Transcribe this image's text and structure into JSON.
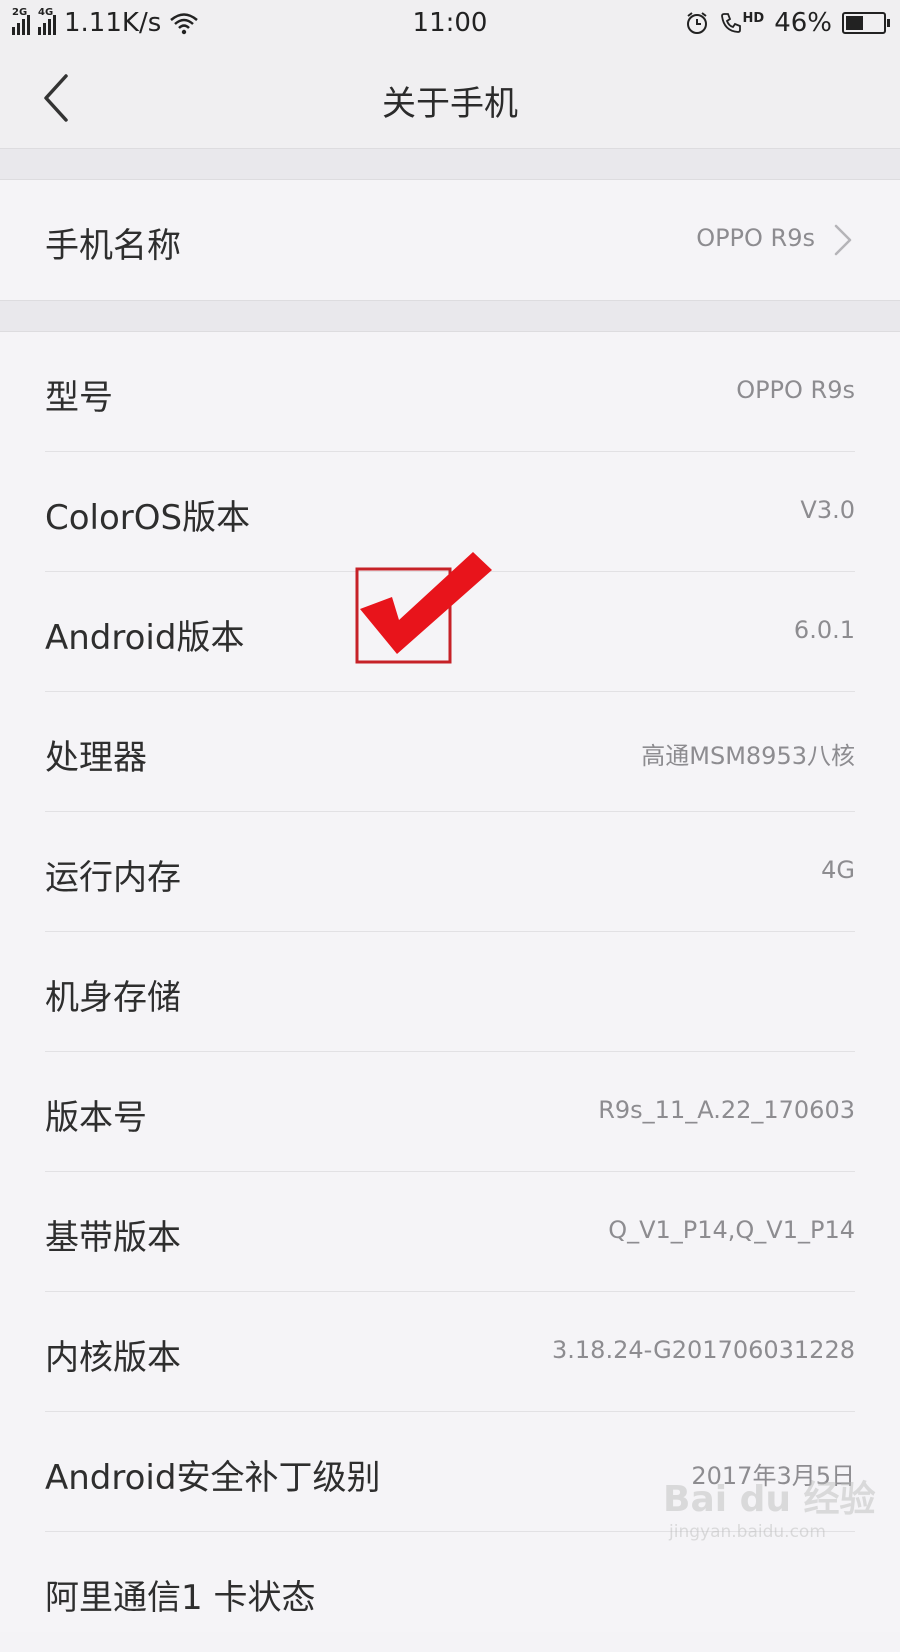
{
  "status_bar": {
    "signal_1_label": "2G",
    "signal_2_label": "4G",
    "net_speed": "1.11K/s",
    "time": "11:00",
    "call_hd_label": "HD",
    "battery_percent": "46%",
    "battery_level": 0.46
  },
  "nav": {
    "title": "关于手机"
  },
  "name_row": {
    "label": "手机名称",
    "value": "OPPO R9s"
  },
  "info_rows": [
    {
      "label": "型号",
      "value": "OPPO R9s"
    },
    {
      "label": "ColorOS版本",
      "value": "V3.0"
    },
    {
      "label": "Android版本",
      "value": "6.0.1"
    },
    {
      "label": "处理器",
      "value": "高通MSM8953八核"
    },
    {
      "label": "运行内存",
      "value": "4G"
    },
    {
      "label": "机身存储",
      "value": ""
    },
    {
      "label": "版本号",
      "value": "R9s_11_A.22_170603"
    },
    {
      "label": "基带版本",
      "value": "Q_V1_P14,Q_V1_P14"
    },
    {
      "label": "内核版本",
      "value": "3.18.24-G201706031228"
    },
    {
      "label": "Android安全补丁级别",
      "value": "2017年3月5日"
    },
    {
      "label": "阿里通信1 卡状态",
      "value": ""
    }
  ],
  "watermark": {
    "brand": "Bai du 经验",
    "site": "jingyan.baidu.com"
  },
  "colors": {
    "check_mark": "#e8141b",
    "background": "#f4f3f6",
    "secondary_text": "#8d8c90"
  }
}
